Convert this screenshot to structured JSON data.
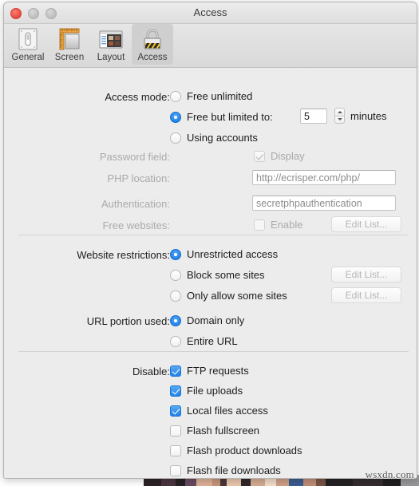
{
  "window": {
    "title": "Access",
    "traffic_lights": [
      {
        "name": "close",
        "color": "#e8483c"
      },
      {
        "name": "minimize",
        "color": "#bcbcbc"
      },
      {
        "name": "zoom",
        "color": "#bcbcbc"
      }
    ]
  },
  "toolbar": {
    "items": [
      {
        "label": "General",
        "icon": "switch-icon",
        "selected": false
      },
      {
        "label": "Screen",
        "icon": "ruler-icon",
        "selected": false
      },
      {
        "label": "Layout",
        "icon": "window-layout-icon",
        "selected": false
      },
      {
        "label": "Access",
        "icon": "padlock-icon",
        "selected": true
      }
    ]
  },
  "access_mode": {
    "label": "Access mode:",
    "options": [
      {
        "label": "Free unlimited",
        "selected": false
      },
      {
        "label": "Free but limited to:",
        "selected": true
      },
      {
        "label": "Using accounts",
        "selected": false
      }
    ],
    "minutes_value": "5",
    "minutes_unit": "minutes"
  },
  "password_field": {
    "label": "Password field:",
    "checkbox_label": "Display",
    "checked": true,
    "enabled": false
  },
  "php_location": {
    "label": "PHP location:",
    "value": "http://ecrisper.com/php/",
    "enabled": false
  },
  "authentication": {
    "label": "Authentication:",
    "value": "secretphpauthentication",
    "enabled": false
  },
  "free_websites": {
    "label": "Free websites:",
    "checkbox_label": "Enable",
    "checked": false,
    "button_label": "Edit List...",
    "enabled": false
  },
  "website_restrictions": {
    "label": "Website restrictions:",
    "options": [
      {
        "label": "Unrestricted access",
        "selected": true,
        "button": null
      },
      {
        "label": "Block some sites",
        "selected": false,
        "button": "Edit List..."
      },
      {
        "label": "Only allow some sites",
        "selected": false,
        "button": "Edit List..."
      }
    ]
  },
  "url_portion": {
    "label": "URL portion used:",
    "options": [
      {
        "label": "Domain only",
        "selected": true
      },
      {
        "label": "Entire URL",
        "selected": false
      }
    ]
  },
  "disable": {
    "label": "Disable:",
    "items": [
      {
        "label": "FTP requests",
        "checked": true
      },
      {
        "label": "File uploads",
        "checked": true
      },
      {
        "label": "Local files access",
        "checked": true
      },
      {
        "label": "Flash fullscreen",
        "checked": false
      },
      {
        "label": "Flash product downloads",
        "checked": false
      },
      {
        "label": "Flash file downloads",
        "checked": false
      }
    ]
  },
  "watermark": {
    "text": "wsxdn.com"
  },
  "colors": {
    "accent": "#1b7ee8",
    "window_bg": "#ececec",
    "toolbar_selected": "#cfcfcf"
  }
}
